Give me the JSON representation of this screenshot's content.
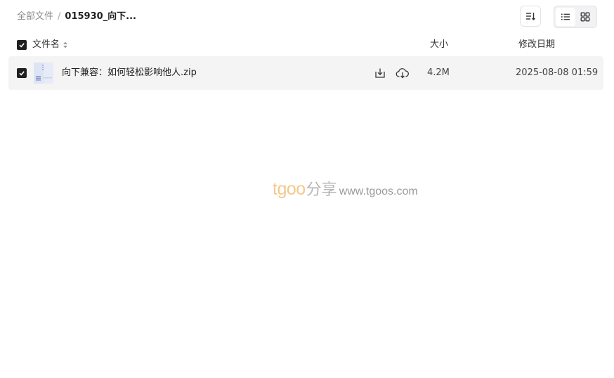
{
  "breadcrumb": {
    "root": "全部文件",
    "separator": "/",
    "current": "015930_向下..."
  },
  "toolbar": {
    "sort_icon": "sort-icon",
    "view_list_icon": "list-view-icon",
    "view_grid_icon": "grid-view-icon",
    "active_view": "list"
  },
  "table": {
    "columns": {
      "name": "文件名",
      "size": "大小",
      "modified": "修改日期"
    },
    "select_all_checked": true,
    "rows": [
      {
        "checked": true,
        "icon": "zip-file-icon",
        "name": "向下兼容：如何轻松影响他人.zip",
        "size": "4.2M",
        "modified": "2025-08-08 01:59",
        "actions": [
          "download-icon",
          "cloud-save-icon"
        ]
      }
    ]
  },
  "watermark": {
    "brand": "tgoo",
    "suffix": "分享",
    "url": "www.tgoos.com"
  },
  "colors": {
    "row_highlight": "#f4f4f5",
    "checkbox": "#1f1f1f",
    "watermark_brand": "#f3c98a"
  }
}
